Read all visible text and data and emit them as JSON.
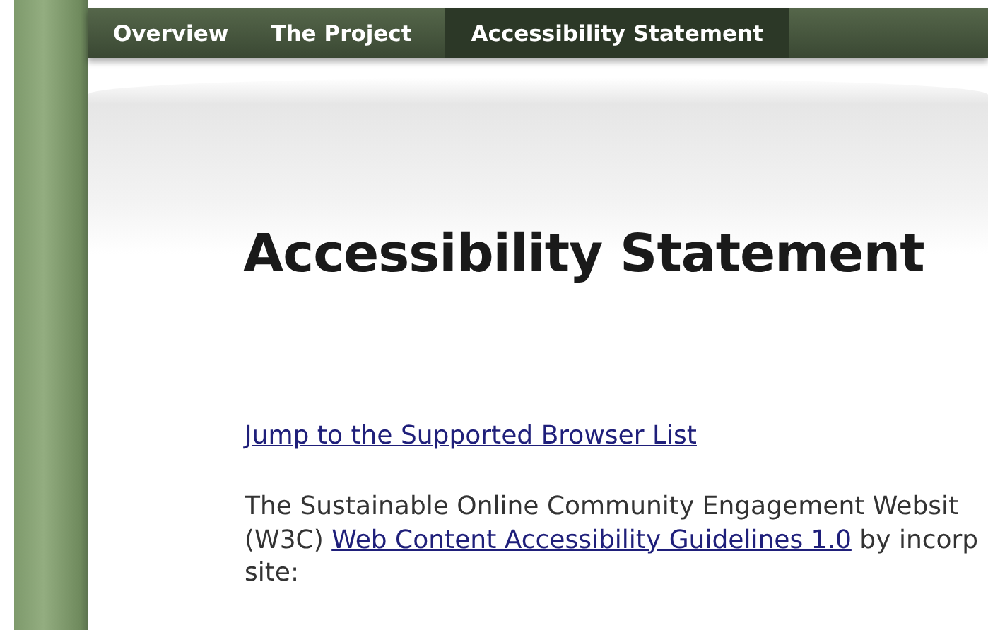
{
  "nav": {
    "tabs": [
      {
        "label": "Overview",
        "selected": false
      },
      {
        "label": "The Project",
        "selected": false
      },
      {
        "label": "Accessibility Statement",
        "selected": true
      }
    ]
  },
  "content": {
    "heading": "Accessibility Statement",
    "jump_link": "Jump to the Supported Browser List",
    "paragraph": {
      "line_1": "The Sustainable Online Community Engagement Websit",
      "line_2_before": "(W3C) ",
      "line_2_link": "Web Content Accessibility Guidelines 1.0",
      "line_2_after": " by incorp",
      "line_3": "site:"
    }
  }
}
